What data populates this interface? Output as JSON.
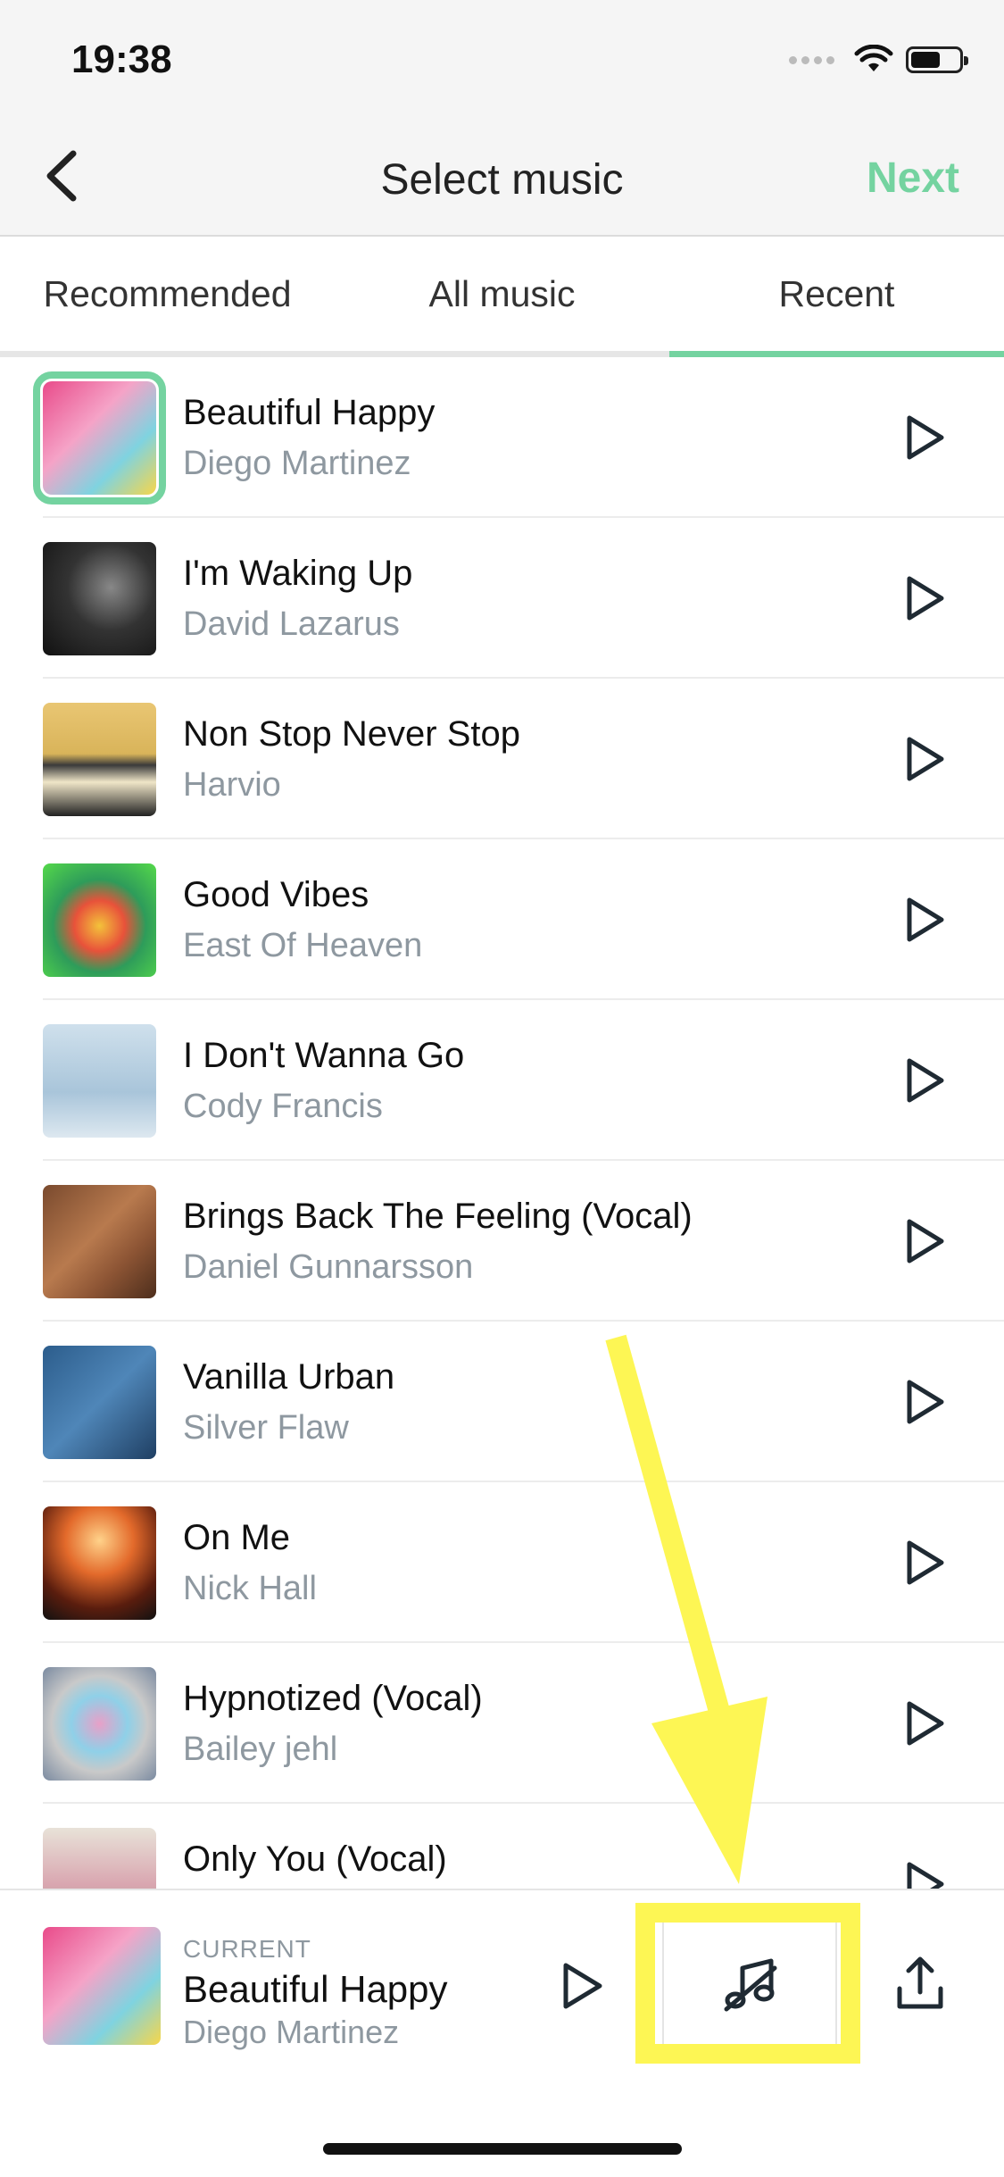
{
  "status_bar": {
    "time": "19:38"
  },
  "nav": {
    "title": "Select music",
    "next_label": "Next"
  },
  "tabs": [
    {
      "label": "Recommended",
      "active": false
    },
    {
      "label": "All music",
      "active": false
    },
    {
      "label": "Recent",
      "active": true
    }
  ],
  "songs": [
    {
      "title": "Beautiful Happy",
      "artist": "Diego Martinez",
      "selected": true
    },
    {
      "title": "I'm Waking Up",
      "artist": "David Lazarus"
    },
    {
      "title": "Non Stop Never Stop",
      "artist": "Harvio"
    },
    {
      "title": "Good Vibes",
      "artist": "East Of Heaven"
    },
    {
      "title": "I Don't Wanna Go",
      "artist": "Cody Francis"
    },
    {
      "title": "Brings Back The Feeling (Vocal)",
      "artist": "Daniel Gunnarsson"
    },
    {
      "title": "Vanilla Urban",
      "artist": "Silver Flaw"
    },
    {
      "title": "On Me",
      "artist": "Nick Hall"
    },
    {
      "title": "Hypnotized (Vocal)",
      "artist": "Bailey jehl"
    },
    {
      "title": "Only You (Vocal)",
      "artist": ""
    }
  ],
  "current": {
    "label": "CURRENT",
    "title": "Beautiful Happy",
    "artist": "Diego Martinez"
  },
  "colors": {
    "accent": "#74d3a0",
    "highlight": "#fdf654",
    "muted_text": "#8e98a0"
  },
  "icons": {
    "back": "chevron-left-icon",
    "play": "play-icon",
    "music": "music-note-icon",
    "share": "share-icon"
  }
}
